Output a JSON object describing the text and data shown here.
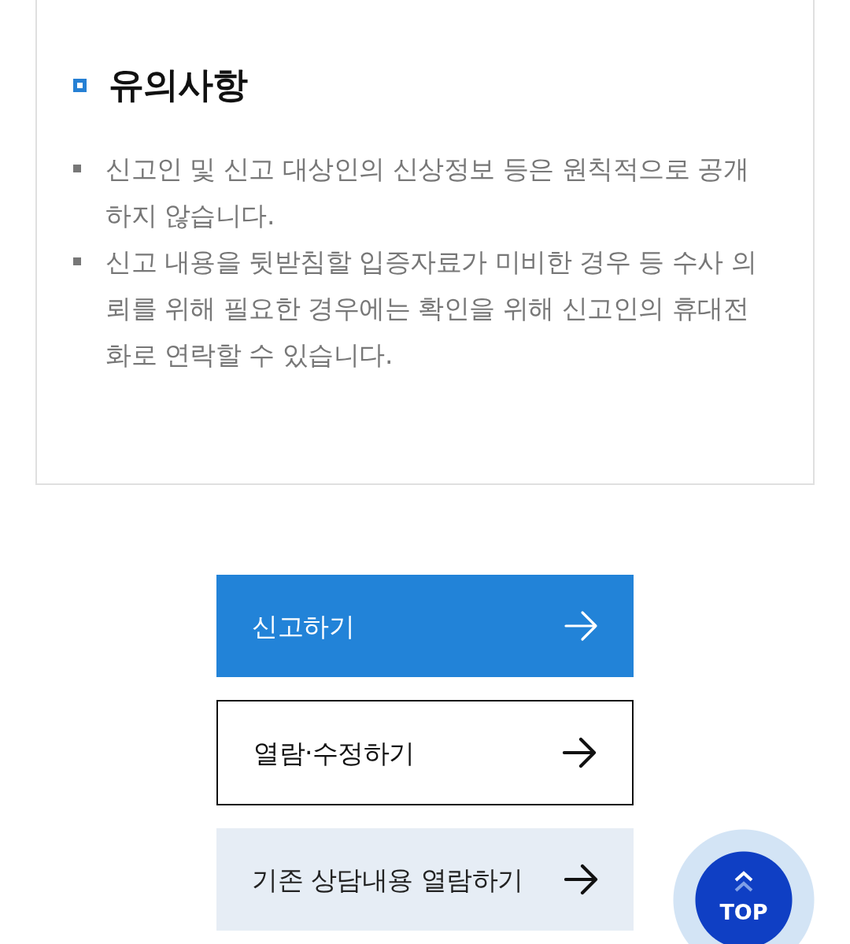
{
  "notice": {
    "title": "유의사항",
    "items": [
      "신고인 및 신고 대상인의 신상정보 등은 원칙적으로 공개하지 않습니다.",
      "신고 내용을 뒷받침할 입증자료가 미비한 경우 등 수사 의뢰를 위해 필요한 경우에는 확인을 위해 신고인의 휴대전화로 연락할 수 있습니다."
    ]
  },
  "buttons": [
    {
      "label": "신고하기",
      "kind": "primary"
    },
    {
      "label": "열람·수정하기",
      "kind": "outline"
    },
    {
      "label": "기존 상담내용 열람하기",
      "kind": "light"
    }
  ],
  "top_button": {
    "label": "TOP"
  }
}
